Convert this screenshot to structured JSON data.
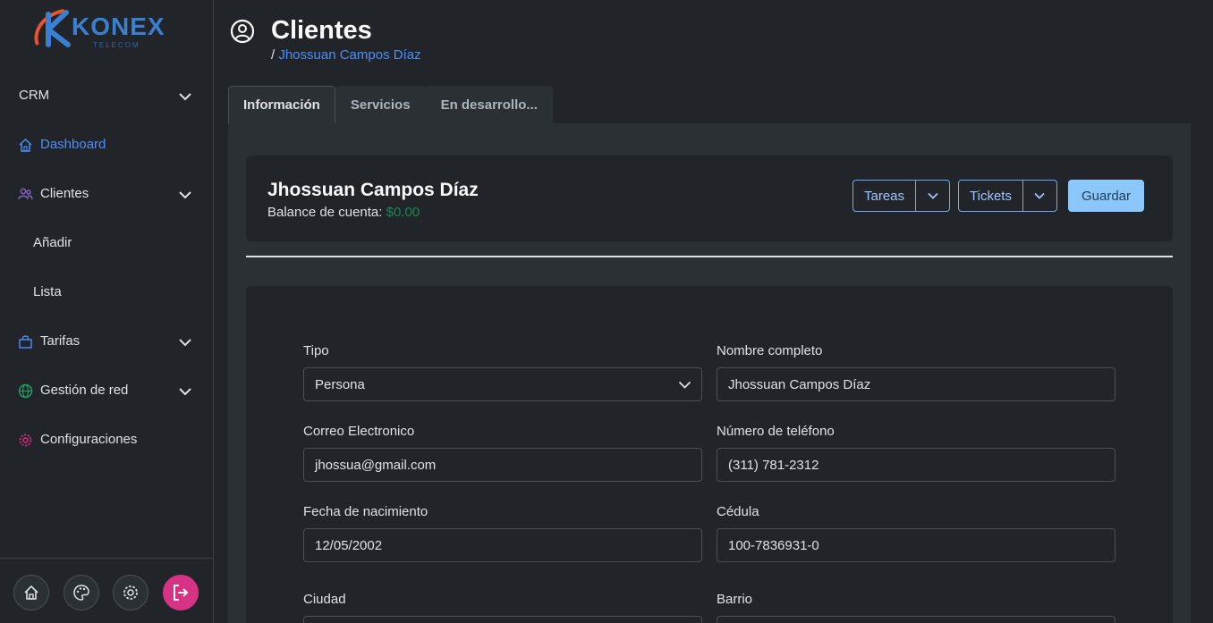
{
  "brand": {
    "name": "KONEX",
    "sub": "TELECOM"
  },
  "sidebar": {
    "items": [
      {
        "label": "CRM"
      },
      {
        "label": "Dashboard"
      },
      {
        "label": "Clientes"
      },
      {
        "label": "Añadir"
      },
      {
        "label": "Lista"
      },
      {
        "label": "Tarifas"
      },
      {
        "label": "Gestión de red"
      },
      {
        "label": "Configuraciones"
      }
    ],
    "footer_icons": [
      "home-icon",
      "palette-icon",
      "gear-icon",
      "logout-icon"
    ]
  },
  "page": {
    "title": "Clientes",
    "breadcrumb_sep": "/",
    "breadcrumb_current": "Jhossuan Campos Díaz"
  },
  "tabs": [
    {
      "label": "Información"
    },
    {
      "label": "Servicios"
    },
    {
      "label": "En desarrollo..."
    }
  ],
  "client": {
    "name": "Jhossuan Campos Díaz",
    "balance_label": "Balance de cuenta:",
    "balance_value": "$0.00"
  },
  "actions": {
    "tasks_label": "Tareas",
    "tickets_label": "Tickets",
    "save_label": "Guardar"
  },
  "form": {
    "tipo": {
      "label": "Tipo",
      "value": "Persona"
    },
    "nombre": {
      "label": "Nombre completo",
      "value": "Jhossuan Campos Díaz"
    },
    "correo": {
      "label": "Correo Electronico",
      "value": "jhossua@gmail.com"
    },
    "telefono": {
      "label": "Número de teléfono",
      "value": "(311) 781-2312"
    },
    "nacimiento": {
      "label": "Fecha de nacimiento",
      "value": "12/05/2002"
    },
    "cedula": {
      "label": "Cédula",
      "value": "100-7836931-0"
    },
    "ciudad": {
      "label": "Ciudad",
      "value": ""
    },
    "barrio": {
      "label": "Barrio",
      "value": ""
    }
  },
  "colors": {
    "accent": "#4d8df7",
    "success": "#198754",
    "danger": "#d63384",
    "save_button": "#8bc7fb"
  }
}
